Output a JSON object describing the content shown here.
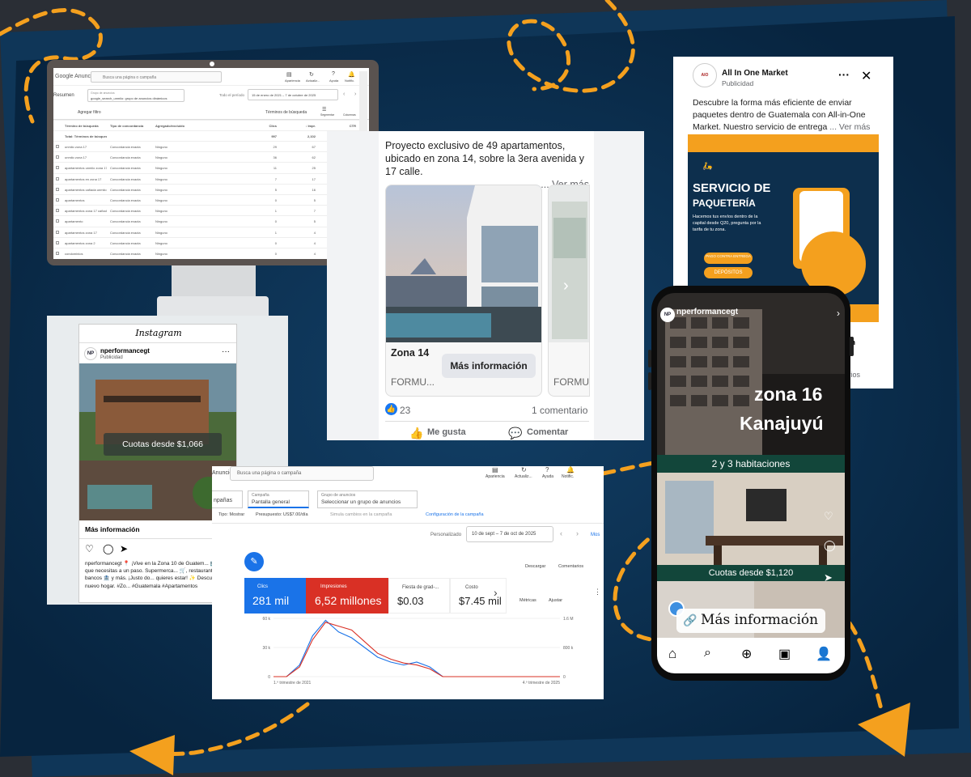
{
  "colors": {
    "accent_orange": "#f4a01e",
    "navy": "#0a2d4a",
    "google_blue": "#1a73e8",
    "google_red": "#d93025",
    "fb_blue": "#1877f2"
  },
  "ads_monitor": {
    "logo": "Google Anuncios",
    "search_placeholder": "Busca una página o campaña",
    "top_icons": [
      "Apariencia",
      "Actualiz...",
      "Ayuda",
      "Notific."
    ],
    "summary_tab": "Resumen",
    "group_label": "Grupo de anuncios",
    "group_value": "google_search_unmiio: grupo de anuncios dinámicos",
    "period_label": "Todo el período",
    "period_value": "15 de enero de 2021 – 7 de octubre de 2025",
    "add_filter": "Agregar filtro",
    "search_terms_btn": "Términos de búsqueda",
    "segment_label": "Segmentar",
    "columns_label": "Columnas",
    "columns": [
      "Término de búsqueda",
      "Tipo de concordancia",
      "Agregado/excluido",
      "Clics",
      "↓ Impr.",
      "CTR"
    ],
    "total_row": [
      "Total: Términos de búsqueda",
      "",
      "",
      "997",
      "2,102",
      "47.96%"
    ],
    "rows": [
      [
        "unmiio zona 17",
        "Concordancia exacta",
        "Ninguno",
        "29",
        "67",
        "53.33%"
      ],
      [
        "unmiio zona 17",
        "Concordancia exacta",
        "Ninguno",
        "36",
        "62",
        "48.39%"
      ],
      [
        "apartamentos unmiio zona 17",
        "Concordancia exacta",
        "Ninguno",
        "11",
        "25",
        "44.00%"
      ],
      [
        "apartamentos en zona 17",
        "Concordancia exacta",
        "Ninguno",
        "7",
        "17",
        "41.18%"
      ],
      [
        "apartamentos cañada unmiio",
        "Concordancia exacta",
        "Ninguno",
        "5",
        "16",
        "31.25%"
      ],
      [
        "apartamentos",
        "Concordancia exacta",
        "Ninguno",
        "0",
        "5",
        "0.00%"
      ],
      [
        "apartamentos zona 17 cañada unmiio guatemala",
        "Concordancia exacta",
        "Ninguno",
        "1",
        "7",
        "14.29%"
      ],
      [
        "apartamento",
        "Concordancia exacta",
        "Ninguno",
        "0",
        "5",
        "0.00%"
      ],
      [
        "apartamentos zona 17",
        "Concordancia exacta",
        "Ninguno",
        "1",
        "4",
        "25.00%"
      ],
      [
        "apartamentos zona 2",
        "Concordancia exacta",
        "Ninguno",
        "0",
        "4",
        "0.00%"
      ],
      [
        "condominios",
        "Concordancia exacta",
        "Ninguno",
        "0",
        "4",
        "0.00%"
      ]
    ]
  },
  "fb_post": {
    "text": "Proyecto exclusivo de 49 apartamentos, ubicado en zona 14, sobre la 3era avenida y 17 calle.",
    "see_more": "... Ver más",
    "card_title": "Zona 14",
    "card_cta": "Más información",
    "card_sub": "FORMU...",
    "card2_sub": "FORMU",
    "reactions": "23",
    "comments": "1 comentario",
    "like": "Me gusta",
    "comment": "Comentar"
  },
  "instagram": {
    "logo": "Instagram",
    "account": "nperformancegt",
    "sponsored": "Publicidad",
    "overlay": "Cuotas desde $1,066",
    "cta": "Más información",
    "caption": "nperformancegt 📍 ¡Vive en la Zona 10 de Guatem... 🏥 Todo lo que necesitas a un paso. Supermerca... 🛒, restaurantes 🍽️, bancos 🏦 y más. ¡Justo do... quieres estar! ✨ Descubre tu nuevo hogar. #Zo... #Guatemala #Apartamentos"
  },
  "ads_bottom": {
    "logo": "Anuncios",
    "search_placeholder": "Busca una página o campaña",
    "top_icons": [
      "Apariencia",
      "Actualiz...",
      "Ayuda",
      "Notific."
    ],
    "tab_campaigns": "npañas",
    "campaign_label": "Campaña",
    "campaign_value": "Pantalla general",
    "group_label": "Grupo de anuncios",
    "group_value": "Seleccionar un grupo de anuncios",
    "type": "Tipo: Mostrar",
    "budget": "Presupuesto: US$7.00/día",
    "simulate": "Simula cambios en la campaña",
    "config": "Configuración de la campaña",
    "custom": "Personalizado",
    "date_range": "10 de sept – 7 de oct de 2025",
    "show_more": "Mos",
    "download": "Descargar",
    "comments": "Comentarios",
    "metrics_btn": "Métricas",
    "adjust_btn": "Ajustar",
    "kpis": [
      {
        "label": "Clics",
        "value": "281 mil"
      },
      {
        "label": "Impresiones",
        "value": "6,52 millones"
      },
      {
        "label": "Fiesta de grad-...",
        "value": "$0.03"
      },
      {
        "label": "Costo",
        "value": "$7.45 mil"
      }
    ]
  },
  "chart_data": {
    "type": "line",
    "x": [
      0,
      1,
      2,
      3,
      4,
      5,
      6,
      7,
      8,
      9,
      10,
      11,
      12,
      13,
      14,
      15,
      16,
      17,
      18,
      19,
      20,
      21,
      22
    ],
    "series": [
      {
        "values": [
          0,
          0,
          12000,
          42000,
          58000,
          46000,
          40000,
          30000,
          20000,
          15000,
          12000,
          15000,
          10000,
          0,
          0,
          0,
          0,
          0,
          0,
          0,
          0,
          0,
          0
        ]
      },
      {
        "values": [
          0,
          0,
          10000,
          38000,
          56000,
          52000,
          48000,
          36000,
          24000,
          18000,
          14000,
          12000,
          8000,
          0,
          0,
          0,
          0,
          0,
          0,
          0,
          0,
          0,
          0
        ]
      }
    ],
    "xtick_labels": [
      "1.º trimestre de 2021",
      "4.º trimestre de 2025"
    ],
    "left_ticks": [
      "60 k",
      "30 k",
      "0"
    ],
    "right_ticks": [
      "1.6 M",
      "800 k",
      "0"
    ],
    "ylim": [
      0,
      60000
    ]
  },
  "aio": {
    "page": "All In One Market",
    "sponsored": "Publicidad",
    "body": "Descubre la forma más eficiente de enviar paquetes dentro de Guatemala con All-in-One Market. Nuestro servicio de entrega",
    "see_more": "... Ver más",
    "ad_title1": "SERVICIO DE",
    "ad_title2": "PAQUETERÍA",
    "ad_desc": "Hacemos tus envíos dentro de la capital desde Q20, pregunta por la tarifa de tu zona.",
    "tags": [
      "PAGO CONTRA ENTREGA",
      "DEPÓSITOS"
    ],
    "cta_partial": "ón",
    "comments_partial": "ntarios"
  },
  "phone": {
    "account": "nperformancegt",
    "overlay1": "zona 16",
    "overlay2": "Kanajuyú",
    "band1": "2 y 3 habitaciones",
    "band2": "Cuotas desde $1,120",
    "cta": "Más información"
  }
}
